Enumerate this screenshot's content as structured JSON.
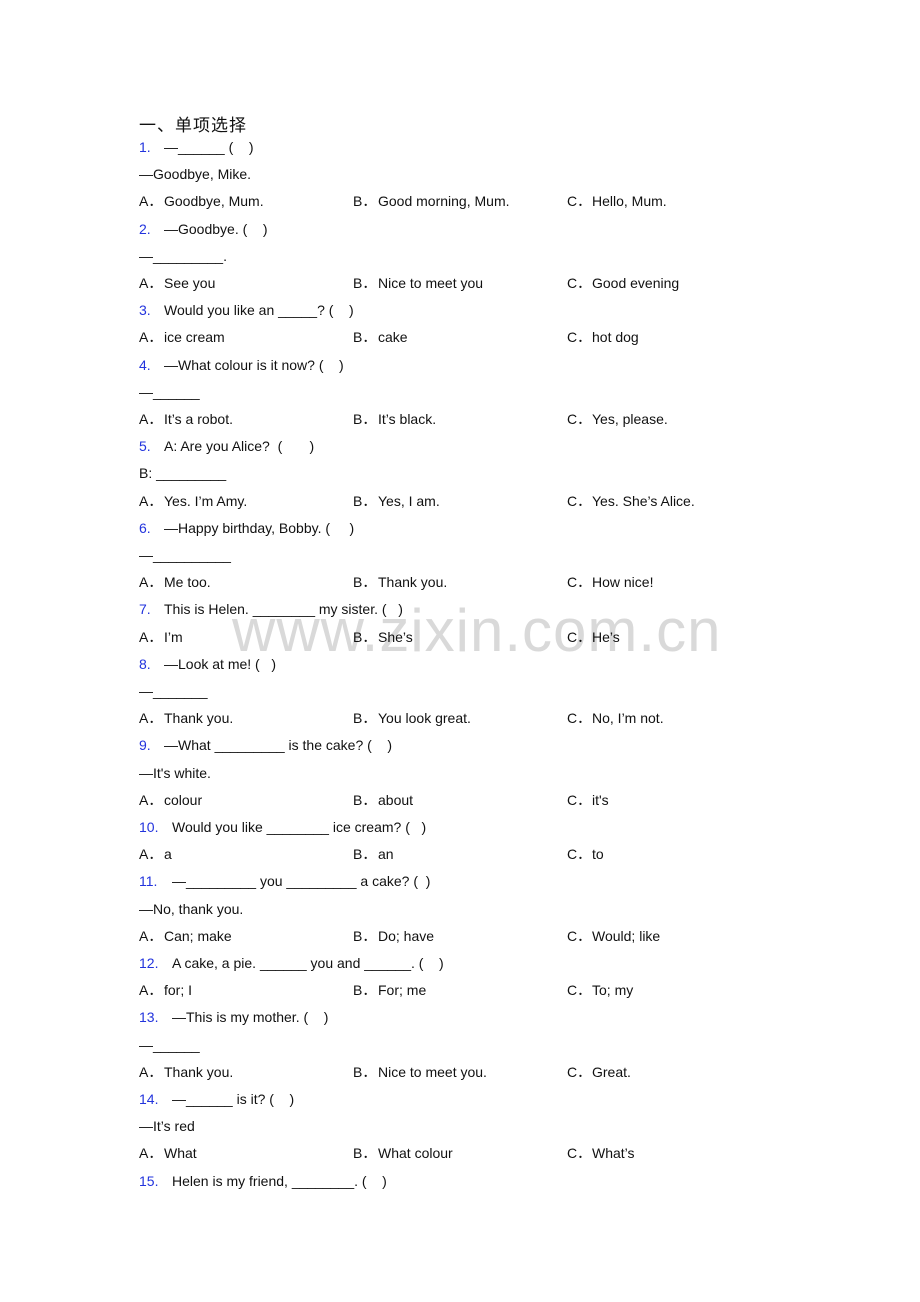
{
  "section_title": "一、单项选择",
  "watermark": "www.zixin.com.cn",
  "colors": {
    "question_number": "#2233dd",
    "text": "#111111",
    "watermark": "#d9d9d9"
  },
  "questions": [
    {
      "num": "1.",
      "stem": "—______ (    )",
      "extra": [
        "—Goodbye, Mike."
      ],
      "options": [
        {
          "letter": "A．",
          "text": "Goodbye, Mum."
        },
        {
          "letter": "B．",
          "text": "Good morning, Mum."
        },
        {
          "letter": "C．",
          "text": "Hello, Mum."
        }
      ]
    },
    {
      "num": "2.",
      "stem": "—Goodbye. (    )",
      "extra": [
        "—_________."
      ],
      "options": [
        {
          "letter": "A．",
          "text": "See you"
        },
        {
          "letter": "B．",
          "text": "Nice to meet you"
        },
        {
          "letter": "C．",
          "text": "Good evening"
        }
      ]
    },
    {
      "num": "3.",
      "stem": "Would you like an _____? (    )",
      "extra": [],
      "options": [
        {
          "letter": "A．",
          "text": "ice cream"
        },
        {
          "letter": "B．",
          "text": "cake"
        },
        {
          "letter": "C．",
          "text": "hot dog"
        }
      ]
    },
    {
      "num": "4.",
      "stem": "—What colour is it now? (    )",
      "extra": [
        "—______"
      ],
      "options": [
        {
          "letter": "A．",
          "text": "It’s a robot."
        },
        {
          "letter": "B．",
          "text": "It’s black."
        },
        {
          "letter": "C．",
          "text": "Yes, please."
        }
      ]
    },
    {
      "num": "5.",
      "stem": "A: Are you Alice?  (       )",
      "extra": [
        "B: _________"
      ],
      "options": [
        {
          "letter": "A．",
          "text": "Yes. I’m Amy."
        },
        {
          "letter": "B．",
          "text": "Yes, I am."
        },
        {
          "letter": "C．",
          "text": "Yes. She’s Alice."
        }
      ]
    },
    {
      "num": "6.",
      "stem": "—Happy birthday, Bobby. (     )",
      "extra": [
        "—__________"
      ],
      "options": [
        {
          "letter": "A．",
          "text": "Me too."
        },
        {
          "letter": "B．",
          "text": "Thank you."
        },
        {
          "letter": "C．",
          "text": "How nice!"
        }
      ]
    },
    {
      "num": "7.",
      "stem": "This is Helen. ________ my sister. (   )",
      "extra": [],
      "options": [
        {
          "letter": "A．",
          "text": "I’m"
        },
        {
          "letter": "B．",
          "text": "She’s"
        },
        {
          "letter": "C．",
          "text": "He’s"
        }
      ]
    },
    {
      "num": "8.",
      "stem": "—Look at me! (   )",
      "extra": [
        "—_______"
      ],
      "options": [
        {
          "letter": "A．",
          "text": "Thank you."
        },
        {
          "letter": "B．",
          "text": "You look great."
        },
        {
          "letter": "C．",
          "text": "No, I’m not."
        }
      ]
    },
    {
      "num": "9.",
      "stem": "—What _________ is the cake? (    )",
      "extra": [
        "—It's white."
      ],
      "options": [
        {
          "letter": "A．",
          "text": "colour"
        },
        {
          "letter": "B．",
          "text": "about"
        },
        {
          "letter": "C．",
          "text": "it's"
        }
      ]
    },
    {
      "num": "10.",
      "stem": "Would you like ________ ice cream? (   )",
      "extra": [],
      "options": [
        {
          "letter": "A．",
          "text": "a"
        },
        {
          "letter": "B．",
          "text": "an"
        },
        {
          "letter": "C．",
          "text": "to"
        }
      ]
    },
    {
      "num": "11.",
      "stem": "—_________ you _________ a cake? (  )",
      "extra": [
        "—No, thank you."
      ],
      "options": [
        {
          "letter": "A．",
          "text": "Can; make"
        },
        {
          "letter": "B．",
          "text": "Do; have"
        },
        {
          "letter": "C．",
          "text": "Would; like"
        }
      ]
    },
    {
      "num": "12.",
      "stem": "A cake, a pie. ______ you and ______. (    )",
      "extra": [],
      "options": [
        {
          "letter": "A．",
          "text": "for; I"
        },
        {
          "letter": "B．",
          "text": "For; me"
        },
        {
          "letter": "C．",
          "text": "To; my"
        }
      ]
    },
    {
      "num": "13.",
      "stem": "—This is my mother. (    )",
      "extra": [
        "—______"
      ],
      "options": [
        {
          "letter": "A．",
          "text": "Thank you."
        },
        {
          "letter": "B．",
          "text": "Nice to meet you."
        },
        {
          "letter": "C．",
          "text": "Great."
        }
      ]
    },
    {
      "num": "14.",
      "stem": "—______ is it? (    )",
      "extra": [
        "—It’s red"
      ],
      "options": [
        {
          "letter": "A．",
          "text": "What"
        },
        {
          "letter": "B．",
          "text": "What colour"
        },
        {
          "letter": "C．",
          "text": "What’s"
        }
      ]
    },
    {
      "num": "15.",
      "stem": "Helen is my friend, ________. (    )",
      "extra": [],
      "options": []
    }
  ]
}
